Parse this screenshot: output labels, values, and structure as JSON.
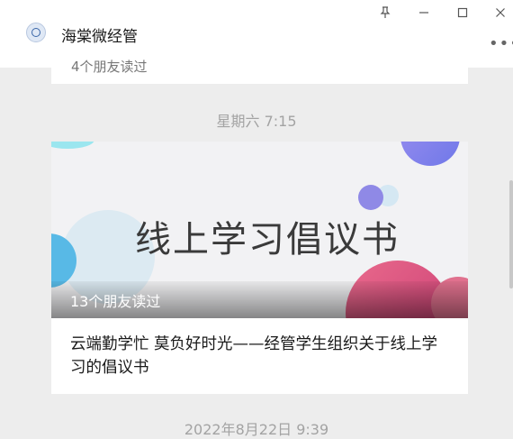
{
  "window": {
    "chat_title": "海棠微经管",
    "pin_icon": "pin-icon",
    "minimize_icon": "minimize-icon",
    "maximize_icon": "maximize-icon",
    "close_icon": "close-icon",
    "more_icon": "more-icon"
  },
  "previous_message": {
    "text": "4个朋友读过"
  },
  "messages": [
    {
      "time": "星期六  7:15",
      "article": {
        "cover_text": "线上学习倡议书",
        "read_count": "13个朋友读过",
        "title": "云端勤学忙 莫负好时光——经管学生组织关于线上学习的倡议书"
      }
    }
  ],
  "next_time": "2022年8月22日  9:39",
  "colors": {
    "background": "#ededed",
    "card": "#ffffff",
    "time_text": "#a3a3a3"
  }
}
